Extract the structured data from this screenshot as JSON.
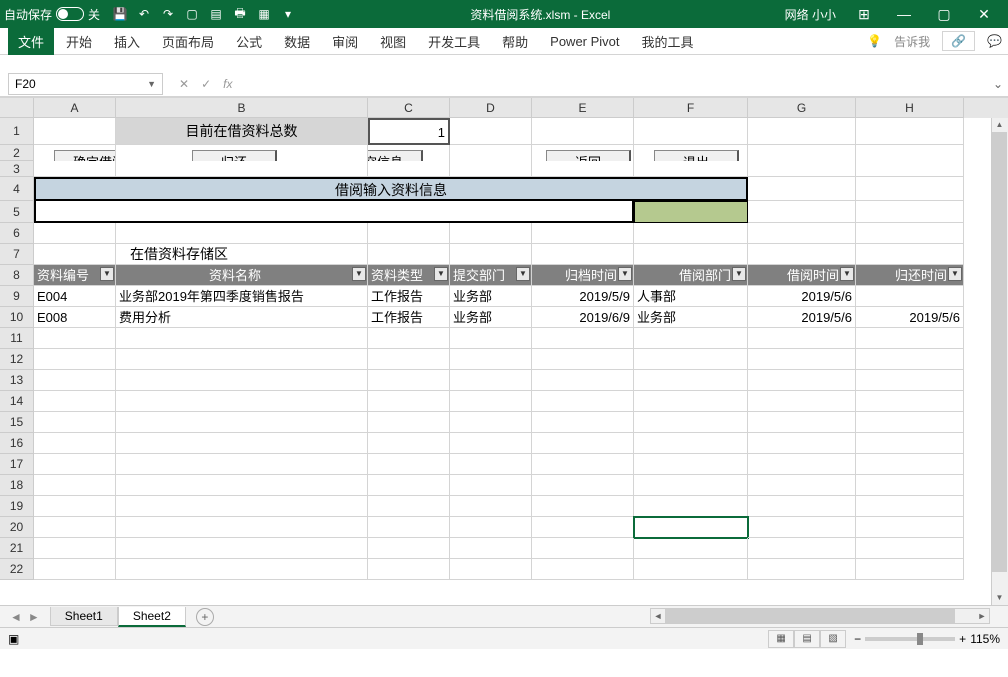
{
  "titlebar": {
    "autosave": "自动保存",
    "autosave_state": "关",
    "filename": "资料借阅系统.xlsm  -  Excel",
    "username": "网络 小小"
  },
  "ribbon": {
    "file": "文件",
    "tabs": [
      "开始",
      "插入",
      "页面布局",
      "公式",
      "数据",
      "审阅",
      "视图",
      "开发工具",
      "帮助",
      "Power Pivot",
      "我的工具"
    ],
    "tellme": "告诉我"
  },
  "formula": {
    "namebox": "F20",
    "fx": "fx"
  },
  "columns": [
    "A",
    "B",
    "C",
    "D",
    "E",
    "F",
    "G",
    "H"
  ],
  "rows": [
    "1",
    "2",
    "3",
    "4",
    "5",
    "6",
    "7",
    "8",
    "9",
    "10",
    "11",
    "12",
    "13",
    "14",
    "15",
    "16",
    "17",
    "18",
    "19",
    "20",
    "21",
    "22"
  ],
  "sheet": {
    "title_label": "目前在借资料总数",
    "title_count": "1",
    "btn_confirm": "确定借阅",
    "btn_return": "归还",
    "btn_clear": "清空信息",
    "btn_back": "返回",
    "btn_exit": "退出",
    "input_header": "借阅输入资料信息",
    "storage_label": "在借资料存储区",
    "headers": {
      "code": "资料编号",
      "name": "资料名称",
      "type": "资料类型",
      "dept": "提交部门",
      "archive_time": "归档时间",
      "borrow_dept": "借阅部门",
      "borrow_time": "借阅时间",
      "return_time": "归还时间"
    },
    "data": [
      {
        "code": "E004",
        "name": "业务部2019年第四季度销售报告",
        "type": "工作报告",
        "dept": "业务部",
        "archive_time": "2019/5/9",
        "borrow_dept": "人事部",
        "borrow_time": "2019/5/6",
        "return_time": ""
      },
      {
        "code": "E008",
        "name": "费用分析",
        "type": "工作报告",
        "dept": "业务部",
        "archive_time": "2019/6/9",
        "borrow_dept": "业务部",
        "borrow_time": "2019/5/6",
        "return_time": "2019/5/6"
      }
    ]
  },
  "sheets": {
    "s1": "Sheet1",
    "s2": "Sheet2"
  },
  "status": {
    "zoom": "115%"
  }
}
